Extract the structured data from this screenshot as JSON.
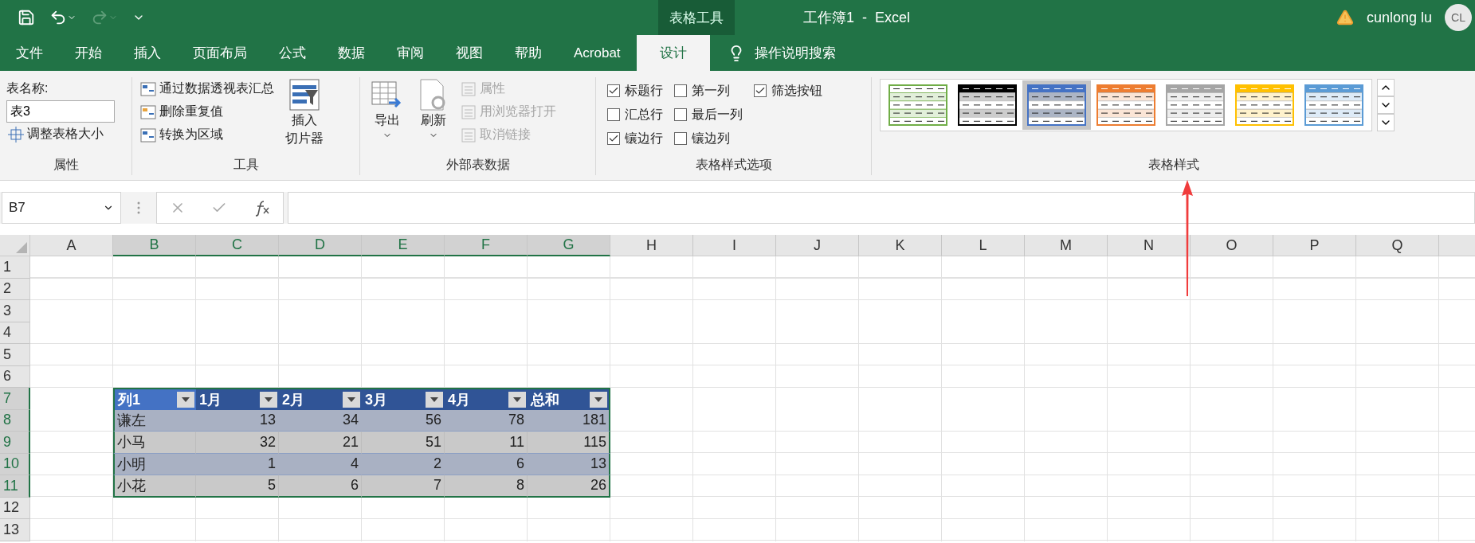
{
  "window": {
    "contextual_group": "表格工具",
    "title": "工作簿1  -  Excel",
    "user": "cunlong lu",
    "avatar": "CL"
  },
  "ribbon_tabs": [
    {
      "label": "文件",
      "selected": false
    },
    {
      "label": "开始",
      "selected": false
    },
    {
      "label": "插入",
      "selected": false
    },
    {
      "label": "页面布局",
      "selected": false
    },
    {
      "label": "公式",
      "selected": false
    },
    {
      "label": "数据",
      "selected": false
    },
    {
      "label": "审阅",
      "selected": false
    },
    {
      "label": "视图",
      "selected": false
    },
    {
      "label": "帮助",
      "selected": false
    },
    {
      "label": "Acrobat",
      "selected": false
    },
    {
      "label": "设计",
      "selected": true
    }
  ],
  "tell_me": {
    "placeholder": "操作说明搜索"
  },
  "ribbon": {
    "properties": {
      "name_label": "表名称:",
      "name_value": "表3",
      "resize_button": "调整表格大小",
      "title": "属性"
    },
    "tools": {
      "buttons": [
        "通过数据透视表汇总",
        "删除重复值",
        "转换为区域"
      ],
      "slicer_button": [
        "插入",
        "切片器"
      ],
      "title": "工具"
    },
    "external": {
      "export_button": "导出",
      "refresh_button": "刷新",
      "items": [
        {
          "label": "属性",
          "disabled": true
        },
        {
          "label": "用浏览器打开",
          "disabled": true
        },
        {
          "label": "取消链接",
          "disabled": true
        }
      ],
      "title": "外部表数据"
    },
    "style_options": {
      "options": [
        {
          "label": "标题行",
          "checked": true
        },
        {
          "label": "汇总行",
          "checked": false
        },
        {
          "label": "镶边行",
          "checked": true
        },
        {
          "label": "第一列",
          "checked": false
        },
        {
          "label": "最后一列",
          "checked": false
        },
        {
          "label": "镶边列",
          "checked": false
        },
        {
          "label": "筛选按钮",
          "checked": true
        }
      ],
      "title": "表格样式选项"
    },
    "table_styles": {
      "styles": [
        {
          "kind": "light",
          "color": "#70ad47",
          "selected": false
        },
        {
          "kind": "medium",
          "color": "#000000",
          "selected": false
        },
        {
          "kind": "medium",
          "color": "#4472c4",
          "selected": true
        },
        {
          "kind": "medium",
          "color": "#ed7d31",
          "selected": false
        },
        {
          "kind": "medium",
          "color": "#a5a5a5",
          "selected": false
        },
        {
          "kind": "medium",
          "color": "#ffc000",
          "selected": false
        },
        {
          "kind": "medium",
          "color": "#5b9bd5",
          "selected": false
        }
      ],
      "title": "表格样式"
    }
  },
  "formula_bar": {
    "name_box": "B7"
  },
  "sheet": {
    "columns": [
      {
        "label": "A",
        "selected": false
      },
      {
        "label": "B",
        "selected": true
      },
      {
        "label": "C",
        "selected": true
      },
      {
        "label": "D",
        "selected": true
      },
      {
        "label": "E",
        "selected": true
      },
      {
        "label": "F",
        "selected": true
      },
      {
        "label": "G",
        "selected": true
      },
      {
        "label": "H",
        "selected": false
      },
      {
        "label": "I",
        "selected": false
      },
      {
        "label": "J",
        "selected": false
      },
      {
        "label": "K",
        "selected": false
      },
      {
        "label": "L",
        "selected": false
      },
      {
        "label": "M",
        "selected": false
      },
      {
        "label": "N",
        "selected": false
      },
      {
        "label": "O",
        "selected": false
      },
      {
        "label": "P",
        "selected": false
      },
      {
        "label": "Q",
        "selected": false
      }
    ],
    "rows": [
      {
        "label": "1",
        "selected": false
      },
      {
        "label": "2",
        "selected": false
      },
      {
        "label": "3",
        "selected": false
      },
      {
        "label": "4",
        "selected": false
      },
      {
        "label": "5",
        "selected": false
      },
      {
        "label": "6",
        "selected": false
      },
      {
        "label": "7",
        "selected": true
      },
      {
        "label": "8",
        "selected": true
      },
      {
        "label": "9",
        "selected": true
      },
      {
        "label": "10",
        "selected": true
      },
      {
        "label": "11",
        "selected": true
      },
      {
        "label": "12",
        "selected": false
      },
      {
        "label": "13",
        "selected": false
      }
    ],
    "table": {
      "headers": [
        {
          "label": "列1",
          "selected": true
        },
        {
          "label": "1月",
          "selected": false
        },
        {
          "label": "2月",
          "selected": false
        },
        {
          "label": "3月",
          "selected": false
        },
        {
          "label": "4月",
          "selected": false
        },
        {
          "label": "总和",
          "selected": false
        }
      ],
      "rows": [
        [
          "谦左",
          "13",
          "34",
          "56",
          "78",
          "181"
        ],
        [
          "小马",
          "32",
          "21",
          "51",
          "11",
          "115"
        ],
        [
          "小明",
          "1",
          "4",
          "2",
          "6",
          "13"
        ],
        [
          "小花",
          "5",
          "6",
          "7",
          "8",
          "26"
        ]
      ]
    }
  }
}
